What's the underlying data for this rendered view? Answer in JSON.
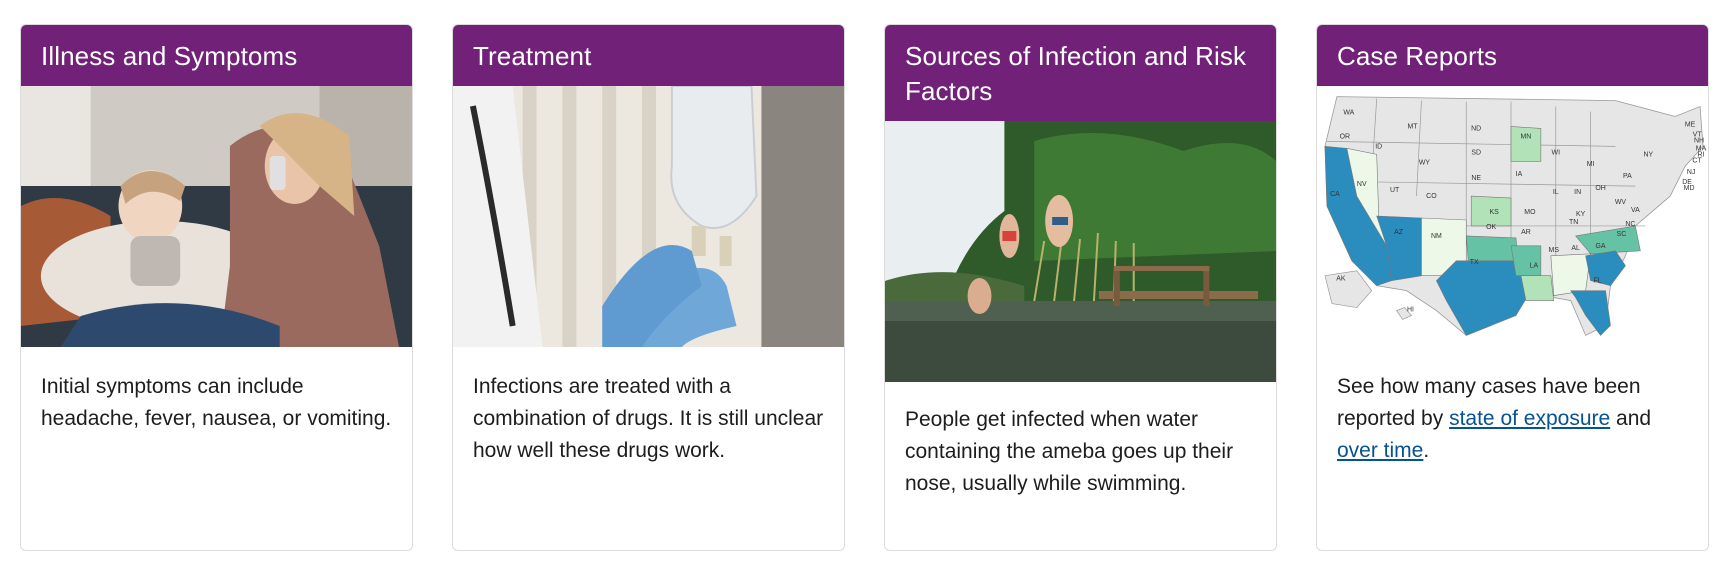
{
  "cards": [
    {
      "title": "Illness and Symptoms",
      "image_alt": "mother-comforting-sick-child",
      "body": "Initial symptoms can include headache, fever, nausea, or vomiting."
    },
    {
      "title": "Treatment",
      "image_alt": "gloved-hands-iv-bag",
      "body": "Infections are treated with a combination of drugs. It is still unclear how well these drugs work."
    },
    {
      "title": "Sources of Infection and Risk Factors",
      "image_alt": "people-jumping-into-lake",
      "body": "People get infected when water containing the ameba goes up their nose, usually while swimming."
    },
    {
      "title": "Case Reports",
      "image_alt": "us-case-map",
      "body_prefix": "See how many cases have been reported by",
      "link1": "state of exposure",
      "body_mid": "and",
      "link2": "over time",
      "body_suffix": "."
    }
  ],
  "map_labels": [
    "WA",
    "OR",
    "ID",
    "MT",
    "ND",
    "MN",
    "SD",
    "WY",
    "NV",
    "UT",
    "CO",
    "NE",
    "IA",
    "WI",
    "MI",
    "IL",
    "IN",
    "OH",
    "KS",
    "MO",
    "KY",
    "WV",
    "VA",
    "PA",
    "NY",
    "ME",
    "VT",
    "NH",
    "MA",
    "RI",
    "CT",
    "NJ",
    "DE",
    "MD",
    "CA",
    "AZ",
    "NM",
    "OK",
    "AR",
    "TN",
    "NC",
    "SC",
    "TX",
    "LA",
    "MS",
    "AL",
    "GA",
    "FL",
    "AK",
    "HI"
  ],
  "colors": {
    "header_bg": "#712177",
    "link": "#075290",
    "map_dark": "#2b8cbe",
    "map_mid": "#66c2a4",
    "map_light": "#b2e2b8",
    "map_pale": "#edf8e9",
    "map_none": "#e6e6e6"
  }
}
